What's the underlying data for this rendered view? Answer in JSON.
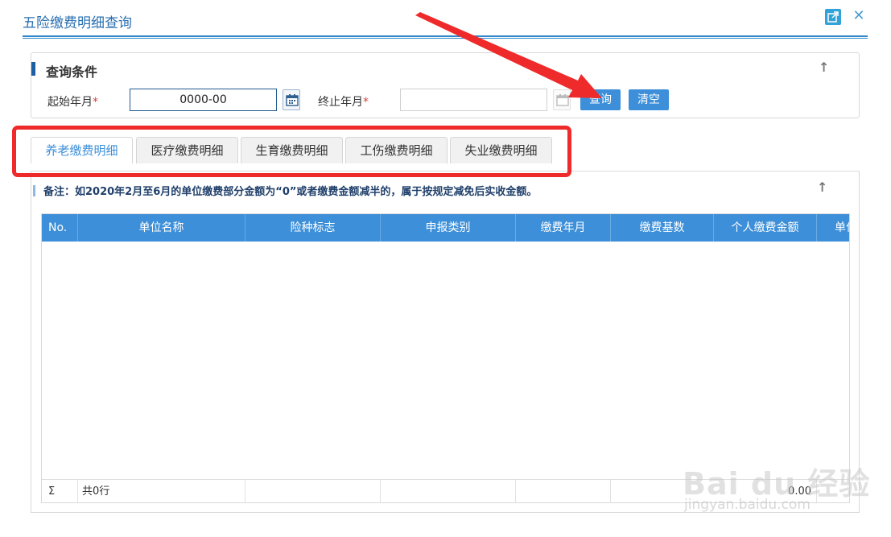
{
  "window": {
    "title": "五险缴费明细查询",
    "external_icon": "external-link-icon",
    "close_icon": "close-icon",
    "close_glyph": "✕"
  },
  "query": {
    "title": "查询条件",
    "collapse_glyph": "↑",
    "start_label": "起始年月",
    "start_value": "0000-00",
    "end_label": "终止年月",
    "end_value": "",
    "required_mark": "*",
    "search_button": "查询",
    "clear_button": "清空",
    "calendar_icon": "calendar-icon"
  },
  "tabs": [
    {
      "label": "养老缴费明细",
      "active": true
    },
    {
      "label": "医疗缴费明细",
      "active": false
    },
    {
      "label": "生育缴费明细",
      "active": false
    },
    {
      "label": "工伤缴费明细",
      "active": false
    },
    {
      "label": "失业缴费明细",
      "active": false
    }
  ],
  "content": {
    "note": "备注：如2020年2月至6月的单位缴费部分金额为“0”或者缴费金额减半的，属于按规定减免后实收金额。",
    "collapse_glyph": "↑"
  },
  "table": {
    "columns": [
      "No.",
      "单位名称",
      "险种标志",
      "申报类别",
      "缴费年月",
      "缴费基数",
      "个人缴费金额",
      "单位"
    ],
    "rows": [],
    "footer": {
      "sigma": "Σ",
      "row_count": "共0行",
      "amount": "0.00"
    }
  },
  "watermark": {
    "main": "Bai du 经验",
    "sub": "jingyan.baidu.com"
  },
  "colors": {
    "accent": "#3c8fd8",
    "title_blue": "#2a6fb0",
    "highlight_red": "#ee2a2a"
  }
}
